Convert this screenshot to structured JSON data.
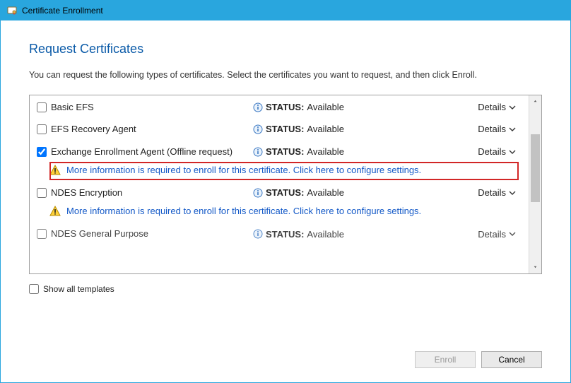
{
  "window": {
    "title": "Certificate Enrollment"
  },
  "page": {
    "heading": "Request Certificates",
    "instruction": "You can request the following types of certificates. Select the certificates you want to request, and then click Enroll."
  },
  "status_label": "STATUS:",
  "details_label": "Details",
  "warning_text": "More information is required to enroll for this certificate. Click here to configure settings.",
  "certs": {
    "basic_efs": {
      "name": "Basic EFS",
      "status": "Available",
      "checked": false
    },
    "efs_recovery": {
      "name": "EFS Recovery Agent",
      "status": "Available",
      "checked": false
    },
    "exchange_agent": {
      "name": "Exchange Enrollment Agent (Offline request)",
      "status": "Available",
      "checked": true
    },
    "ndes_encryption": {
      "name": "NDES Encryption",
      "status": "Available",
      "checked": false
    },
    "ndes_general": {
      "name": "NDES General Purpose",
      "status": "Available",
      "checked": false
    }
  },
  "show_all_label": "Show all templates",
  "buttons": {
    "enroll": "Enroll",
    "cancel": "Cancel"
  }
}
